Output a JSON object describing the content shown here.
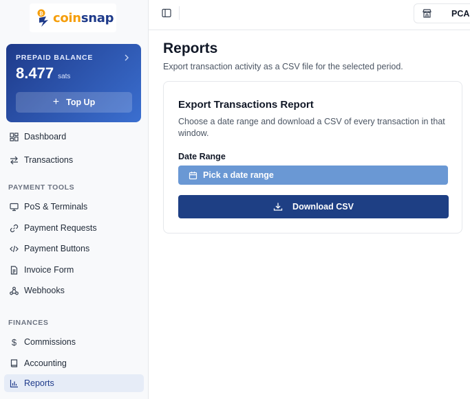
{
  "brand": {
    "logo_prefix": "coin",
    "logo_suffix": "snap"
  },
  "balance": {
    "title": "PREPAID BALANCE",
    "value": "8.477",
    "unit": "sats",
    "topup_label": "Top Up"
  },
  "sidebar": {
    "top_items": [
      {
        "label": "Dashboard",
        "icon": "dashboard-icon"
      },
      {
        "label": "Transactions",
        "icon": "transfer-arrows-icon"
      }
    ],
    "payment_tools": {
      "label": "PAYMENT TOOLS",
      "items": [
        {
          "label": "PoS & Terminals",
          "icon": "monitor-icon"
        },
        {
          "label": "Payment Requests",
          "icon": "link-icon"
        },
        {
          "label": "Payment Buttons",
          "icon": "code-icon"
        },
        {
          "label": "Invoice Form",
          "icon": "document-icon"
        },
        {
          "label": "Webhooks",
          "icon": "webhook-icon"
        }
      ]
    },
    "finances": {
      "label": "FINANCES",
      "items": [
        {
          "label": "Commissions",
          "icon": "dollar-icon"
        },
        {
          "label": "Accounting",
          "icon": "book-icon"
        },
        {
          "label": "Reports",
          "icon": "bar-chart-icon",
          "active": true
        }
      ]
    }
  },
  "topbar": {
    "store_label": "PCA"
  },
  "main": {
    "title": "Reports",
    "subtitle": "Export transaction activity as a CSV file for the selected period.",
    "card": {
      "title": "Export Transactions Report",
      "description": "Choose a date range and download a CSV of every transaction in that window.",
      "date_label": "Date Range",
      "date_button": "Pick a date range",
      "download_button": "Download CSV"
    }
  },
  "colors": {
    "primary": "#1e3f84",
    "accent_light": "#6a98d4",
    "brand_orange": "#f59e0b",
    "active_bg": "#e6ecf7"
  }
}
